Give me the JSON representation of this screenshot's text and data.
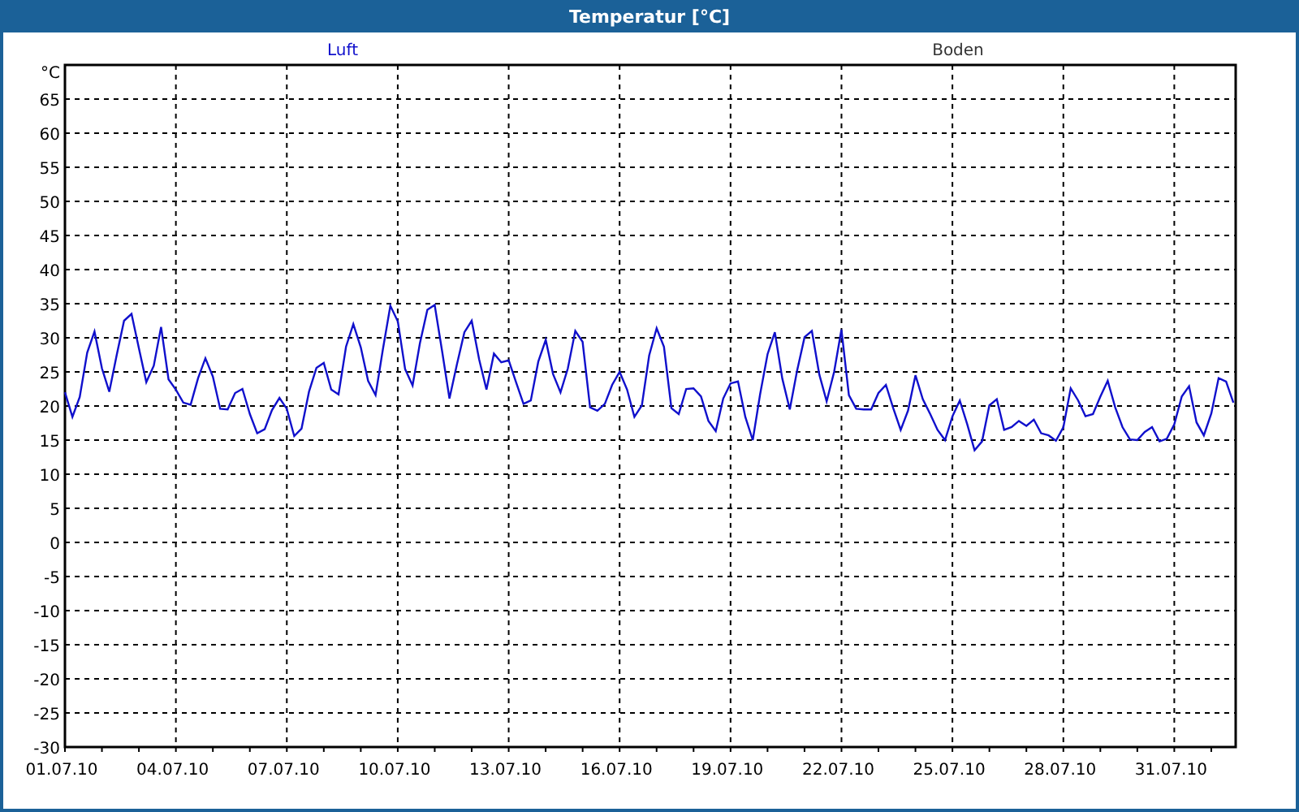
{
  "window": {
    "title": "Temperatur [°C]"
  },
  "chart": {
    "captions": [
      {
        "text": "Boden"
      }
    ],
    "chart_data": {
      "type": "line",
      "grid": true,
      "ylabel": "°C",
      "ylim": [
        -30,
        70
      ],
      "yticks": [
        -30,
        -25,
        -20,
        -15,
        -10,
        -5,
        0,
        5,
        10,
        15,
        20,
        25,
        30,
        35,
        40,
        45,
        50,
        55,
        60,
        65
      ],
      "categories": [
        "01.07.10",
        null,
        null,
        null,
        null,
        null,
        null,
        null,
        null,
        null,
        null,
        null,
        null,
        null,
        null,
        "04.07.10",
        null,
        null,
        null,
        null,
        null,
        null,
        null,
        null,
        null,
        null,
        null,
        null,
        null,
        null,
        "07.07.10",
        null,
        null,
        null,
        null,
        null,
        null,
        null,
        null,
        null,
        null,
        null,
        null,
        null,
        null,
        "10.07.10",
        null,
        null,
        null,
        null,
        null,
        null,
        null,
        null,
        null,
        null,
        null,
        null,
        null,
        null,
        "13.07.10",
        null,
        null,
        null,
        null,
        null,
        null,
        null,
        null,
        null,
        null,
        null,
        null,
        null,
        null,
        "16.07.10",
        null,
        null,
        null,
        null,
        null,
        null,
        null,
        null,
        null,
        null,
        null,
        null,
        null,
        null,
        "19.07.10",
        null,
        null,
        null,
        null,
        null,
        null,
        null,
        null,
        null,
        null,
        null,
        null,
        null,
        null,
        "22.07.10",
        null,
        null,
        null,
        null,
        null,
        null,
        null,
        null,
        null,
        null,
        null,
        null,
        null,
        null,
        "25.07.10",
        null,
        null,
        null,
        null,
        null,
        null,
        null,
        null,
        null,
        null,
        null,
        null,
        null,
        null,
        "28.07.10",
        null,
        null,
        null,
        null,
        null,
        null,
        null,
        null,
        null,
        null,
        null,
        null,
        null,
        null,
        "31.07.10",
        null,
        null,
        null,
        null,
        null,
        null,
        null,
        null
      ],
      "series": [
        {
          "name": "Luft",
          "color": "#1010cc",
          "values": [
            22,
            18.4,
            21.3,
            27.8,
            30.9,
            25.5,
            22.1,
            27.5,
            32.5,
            33.5,
            28.5,
            23.5,
            25.9,
            31.6,
            23.9,
            22.4,
            20.5,
            20.2,
            24.1,
            27.0,
            24.3,
            19.6,
            19.5,
            21.9,
            22.5,
            18.8,
            16.0,
            16.6,
            19.4,
            21.2,
            19.6,
            15.6,
            16.7,
            22.1,
            25.6,
            26.3,
            22.4,
            21.7,
            28.7,
            32.0,
            28.6,
            23.7,
            21.6,
            28.3,
            34.7,
            32.4,
            25.4,
            23,
            29.2,
            34.1,
            34.8,
            28.0,
            21.1,
            26.1,
            30.8,
            32.5,
            26.8,
            22.4,
            27.7,
            26.4,
            26.7,
            23.5,
            20.3,
            20.8,
            26.5,
            29.7,
            24.7,
            22.0,
            25.5,
            31.0,
            29.4,
            19.8,
            19.3,
            20.3,
            23.1,
            25.0,
            22.4,
            18.4,
            20.1,
            27.4,
            31.4,
            28.7,
            19.7,
            18.8,
            22.5,
            22.6,
            21.4,
            17.8,
            16.3,
            21.1,
            23.3,
            23.6,
            18.4,
            15,
            21.7,
            27.6,
            30.8,
            24,
            19.5,
            25.2,
            30.1,
            31,
            24.6,
            20.7,
            25.0,
            31.2,
            21.6,
            19.6,
            19.5,
            19.5,
            21.9,
            23.1,
            19.7,
            16.5,
            19.3,
            24.5,
            21.0,
            18.8,
            16.5,
            15,
            18.5,
            20.8,
            17.3,
            13.5,
            14.8,
            20.1,
            21.0,
            16.5,
            16.9,
            17.8,
            17.1,
            18.0,
            16.0,
            15.7,
            14.9,
            16.9,
            22.6,
            20.8,
            18.5,
            18.8,
            21.4,
            23.7,
            19.8,
            16.9,
            15.1,
            15.0,
            16.2,
            16.9,
            14.8,
            15.2,
            17.3,
            21.4,
            22.9,
            17.6,
            15.7,
            18.9,
            24.1,
            23.6,
            20.5
          ]
        }
      ]
    }
  }
}
